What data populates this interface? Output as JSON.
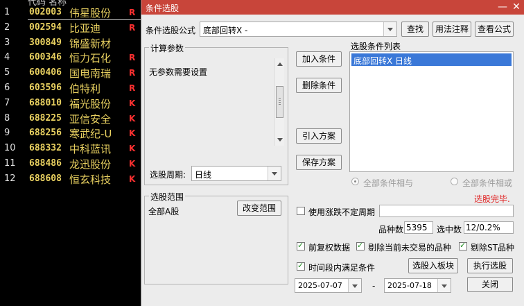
{
  "stock_list": {
    "top_cut": "代码   名称",
    "rows": [
      {
        "idx": "1",
        "code": "002003",
        "name": "伟星股份",
        "flag": "R"
      },
      {
        "idx": "2",
        "code": "002594",
        "name": "比亚迪",
        "flag": "R"
      },
      {
        "idx": "3",
        "code": "300849",
        "name": "锦盛新材",
        "flag": ""
      },
      {
        "idx": "4",
        "code": "600346",
        "name": "恒力石化",
        "flag": "R"
      },
      {
        "idx": "5",
        "code": "600406",
        "name": "国电南瑞",
        "flag": "R"
      },
      {
        "idx": "6",
        "code": "603596",
        "name": "伯特利",
        "flag": "R"
      },
      {
        "idx": "7",
        "code": "688010",
        "name": "福光股份",
        "flag": "K"
      },
      {
        "idx": "8",
        "code": "688225",
        "name": "亚信安全",
        "flag": "K"
      },
      {
        "idx": "9",
        "code": "688256",
        "name": "寒武纪-U",
        "flag": "K"
      },
      {
        "idx": "10",
        "code": "688332",
        "name": "中科蓝讯",
        "flag": "K"
      },
      {
        "idx": "11",
        "code": "688486",
        "name": "龙迅股份",
        "flag": "K"
      },
      {
        "idx": "12",
        "code": "688608",
        "name": "恒玄科技",
        "flag": "K"
      }
    ]
  },
  "dialog": {
    "title": "条件选股",
    "minimize_glyph": "—",
    "close_glyph": "✕",
    "formula_label": "条件选股公式",
    "formula_value": "底部回转X    -",
    "btn_find": "查找",
    "btn_usage": "用法注释",
    "btn_view": "查看公式",
    "params_group": "计算参数",
    "params_text": "无参数需要设置",
    "period_label": "选股周期:",
    "period_value": "日线",
    "btn_add": "加入条件",
    "btn_delete": "删除条件",
    "btn_import": "引入方案",
    "btn_save": "保存方案",
    "cond_list_label": "选股条件列表",
    "cond_items": [
      "底部回转X  日线"
    ],
    "radio_and": "全部条件相与",
    "radio_or": "全部条件相或",
    "status": "选股完毕.",
    "range_group": "选股范围",
    "range_value": "全部A股",
    "btn_change_range": "改变范围",
    "uncertain_period_label": "使用涨跌不定周期",
    "count_label": "品种数",
    "count_value": "5395",
    "selected_label": "选中数",
    "selected_value": "12/0.2%",
    "chk_adjust": "前复权数据",
    "chk_remove_untraded": "剔除当前未交易的品种",
    "chk_remove_st": "剔除ST品种",
    "chk_time_range": "时间段内满足条件",
    "btn_to_block": "选股入板块",
    "btn_execute": "执行选股",
    "date_from": "2025-07-07",
    "date_sep": "-",
    "date_to": "2025-07-18",
    "btn_close": "关闭"
  },
  "colors": {
    "titlebar": "#c8453a",
    "status_red": "#e02020",
    "selection_blue": "#3a78d8",
    "stock_yellow": "#e8d060"
  }
}
